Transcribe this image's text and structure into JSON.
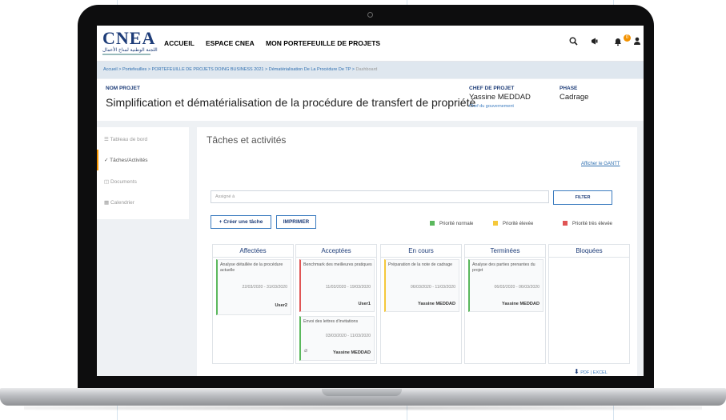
{
  "header": {
    "logo_text": "CNEA",
    "logo_subtitle": "اللجنة الوطنية لمناخ الأعمال",
    "nav": [
      {
        "label": "ACCUEIL",
        "color": "#1d3c78"
      },
      {
        "label": "ESPACE CNEA",
        "color": "#1d3c78"
      },
      {
        "label": "MON PORTEFEUILLE DE PROJETS",
        "color": "#f39200"
      }
    ],
    "icons": [
      "search-icon",
      "megaphone-icon",
      "bell-icon",
      "user-icon"
    ],
    "notification_count": "0"
  },
  "breadcrumb": {
    "items": [
      "Accueil",
      "Portefeuilles",
      "PORTEFEUILLE DE PROJETS DOING BUSINESS 2021",
      "Dématérialisation De La Procédure De TP",
      "Dashboard"
    ],
    "separator": ">"
  },
  "project": {
    "name_label": "NOM PROJET",
    "name": "Simplification et dématérialisation de la procédure de transfert de propriété",
    "chef_label": "CHEF DE PROJET",
    "chef_name": "Yassine MEDDAD",
    "chef_role": "Chef du gouvernement",
    "phase_label": "PHASE",
    "phase": "Cadrage"
  },
  "sidebar": {
    "items": [
      {
        "label": "Tableau de bord",
        "icon": "dashboard-icon"
      },
      {
        "label": "Tâches/Activités",
        "icon": "check-icon",
        "active": true
      },
      {
        "label": "Documents",
        "icon": "document-icon"
      },
      {
        "label": "Calendrier",
        "icon": "calendar-icon"
      }
    ]
  },
  "main": {
    "title": "Tâches et activités",
    "gantt_link": "Afficher le GANTT",
    "filter_placeholder": "Assigné à",
    "filter_button": "FILTER",
    "create_button": "+ Créer une tâche",
    "print_button": "IMPRIMER",
    "legend": [
      {
        "label": "Priorité normale",
        "color": "#5bb85d"
      },
      {
        "label": "Priorité élevée",
        "color": "#f5c83b"
      },
      {
        "label": "Priorité très élevée",
        "color": "#e05555"
      }
    ],
    "export_pdf": "PDF",
    "export_sep": "|",
    "export_excel": "EXCEL"
  },
  "columns": [
    {
      "title": "Affectées",
      "cards": [
        {
          "title": "Analyse détaillée de la procédure actuelle",
          "dates": "22/03/2020 - 31/03/2020",
          "user": "User2",
          "priority_color": "#5bb85d"
        }
      ]
    },
    {
      "title": "Acceptées",
      "cards": [
        {
          "title": "Benchmark des meilleures pratiques",
          "dates": "11/03/2020 - 19/03/2020",
          "user": "User1",
          "priority_color": "#e05555"
        },
        {
          "title": "Envoi des lettres d'invitations",
          "dates": "03/03/2020 - 11/03/2020",
          "user": "Yassine MEDDAD",
          "priority_color": "#5bb85d",
          "attachment": true
        }
      ]
    },
    {
      "title": "En cours",
      "cards": [
        {
          "title": "Préparation de la note de cadrage",
          "dates": "06/03/2020 - 11/03/2020",
          "user": "Yassine MEDDAD",
          "priority_color": "#f5c83b"
        }
      ]
    },
    {
      "title": "Terminées",
      "cards": [
        {
          "title": "Analyse des parties prenantes du projet",
          "dates": "06/03/2020 - 06/03/2020",
          "user": "Yassine MEDDAD",
          "priority_color": "#5bb85d"
        }
      ]
    },
    {
      "title": "Bloquées",
      "cards": []
    }
  ]
}
